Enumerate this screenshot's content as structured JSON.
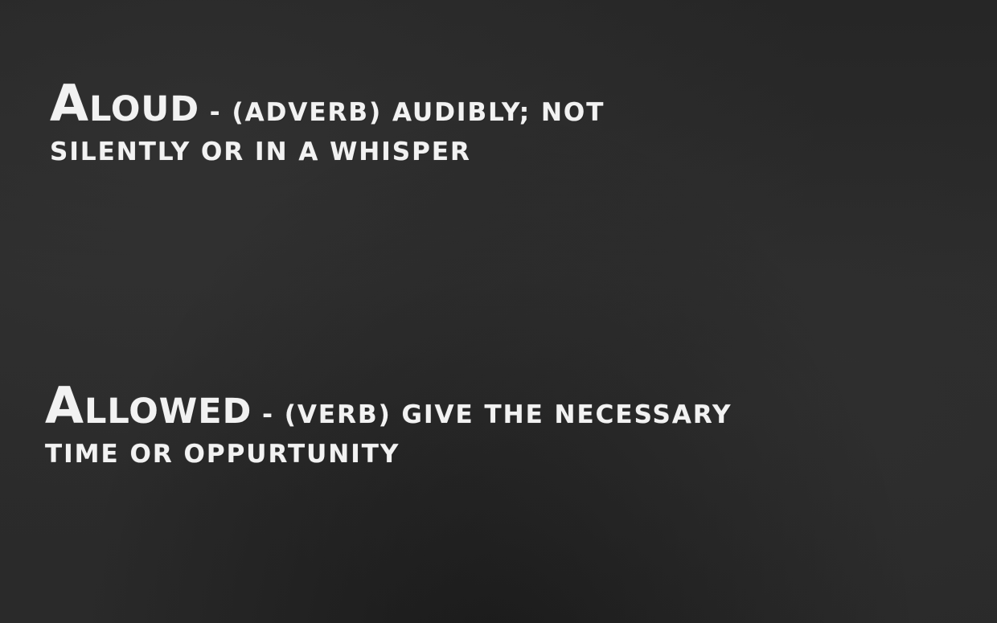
{
  "entries": [
    {
      "word": "Aloud",
      "definition_line1": " - (adverb) audibly; not",
      "definition_line2": "silently or in a whisper"
    },
    {
      "word": "Allowed",
      "definition_line1": " - (verb) give the necessary",
      "definition_line2": "time or oppurtunity"
    }
  ],
  "colors": {
    "chalkboard": "#2a2a2a",
    "chalk": "#f2f2f2"
  }
}
